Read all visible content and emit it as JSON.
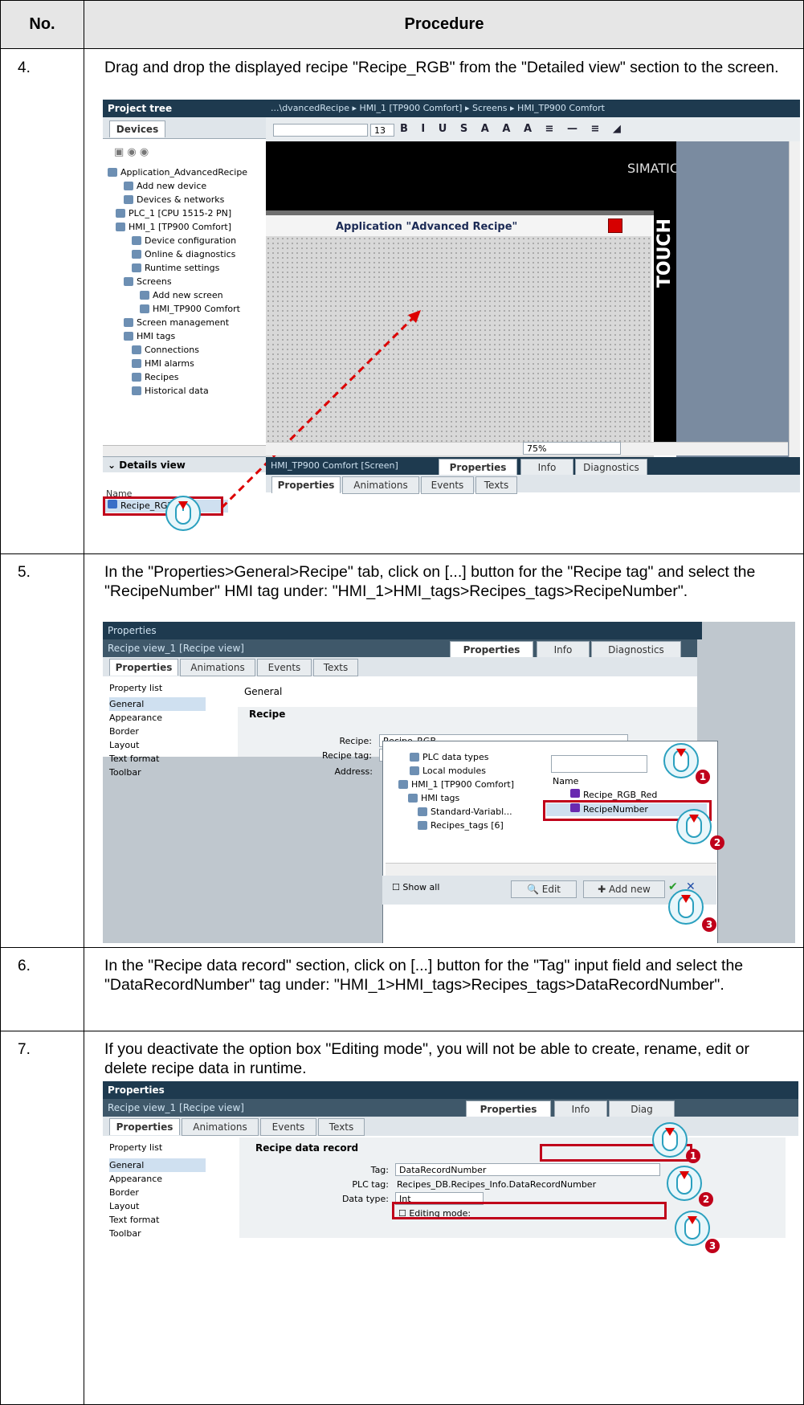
{
  "table": {
    "header_no": "No.",
    "header_procedure": "Procedure"
  },
  "steps": [
    {
      "no": "4.",
      "text": "Drag and drop the displayed recipe \"Recipe_RGB\" from the \"Detailed view\" section to the screen."
    },
    {
      "no": "5.",
      "text": "In the \"Properties>General>Recipe\" tab, click on [...] button for the \"Recipe tag\" and select the \"RecipeNumber\" HMI tag under: \"HMI_1>HMI_tags>Recipes_tags>RecipeNumber\"."
    },
    {
      "no": "6.",
      "text": "In the \"Recipe data record\" section, click on [...] button for the \"Tag\" input field and select the \"DataRecordNumber\" tag under: \"HMI_1>HMI_tags>Recipes_tags>DataRecordNumber\"."
    },
    {
      "no": "7.",
      "text": "If you deactivate the option box \"Editing mode\", you will not be able to create, rename, edit or delete recipe data in runtime."
    }
  ],
  "shot1": {
    "project_tree": "Project tree",
    "devices_tab": "Devices",
    "breadcrumb": "...\\dvancedRecipe ▸ HMI_1 [TP900 Comfort] ▸ Screens ▸ HMI_TP900 Comfort",
    "font_size": "13",
    "tree": [
      "Application_AdvancedRecipe",
      "Add new device",
      "Devices & networks",
      "PLC_1 [CPU 1515-2 PN]",
      "HMI_1 [TP900 Comfort]",
      "Device configuration",
      "Online & diagnostics",
      "Runtime settings",
      "Screens",
      "Add new screen",
      "HMI_TP900 Comfort",
      "Screen management",
      "HMI tags",
      "Connections",
      "HMI alarms",
      "Recipes",
      "Historical data"
    ],
    "details_view": "Details view",
    "name_col": "Name",
    "recipe_item": "Recipe_RGB",
    "simatic": "SIMATIC HMI",
    "touch": "TOUCH",
    "app_title": "Application \"Advanced Recipe\"",
    "zoom": "75%",
    "screen_label": "HMI_TP900 Comfort [Screen]",
    "properties": "Properties",
    "info": "Info",
    "diagnostics": "Diagnostics",
    "tabs": [
      "Properties",
      "Animations",
      "Events",
      "Texts"
    ]
  },
  "shot2": {
    "title": "Properties",
    "object": "Recipe view_1 [Recipe view]",
    "properties": "Properties",
    "info": "Info",
    "diagnostics": "Diagnostics",
    "tabs": [
      "Properties",
      "Animations",
      "Events",
      "Texts"
    ],
    "property_list": "Property list",
    "nav": [
      "General",
      "Appearance",
      "Border",
      "Layout",
      "Text format",
      "Toolbar"
    ],
    "general": "General",
    "section": "Recipe",
    "recipe_label": "Recipe:",
    "recipe_value": "Recipe_RGB",
    "recipe_tag_label": "Recipe tag:",
    "address_label": "Address:",
    "popup_tree": [
      "PLC data types",
      "Local modules",
      "HMI_1 [TP900 Comfort]",
      "HMI tags",
      "Standard-Variabl...",
      "Recipes_tags [6]"
    ],
    "popup_name": "Name",
    "popup_items": [
      "Recipe_RGB_Red",
      "RecipeNumber"
    ],
    "show_all": "Show all",
    "edit": "Edit",
    "add_new": "Add new"
  },
  "shot3": {
    "title": "Properties",
    "object": "Recipe view_1 [Recipe view]",
    "properties": "Properties",
    "info": "Info",
    "diagnostics": "Diag",
    "tabs": [
      "Properties",
      "Animations",
      "Events",
      "Texts"
    ],
    "property_list": "Property list",
    "nav": [
      "General",
      "Appearance",
      "Border",
      "Layout",
      "Text format",
      "Toolbar"
    ],
    "section": "Recipe data record",
    "tag_label": "Tag:",
    "tag_value": "DataRecordNumber",
    "plc_label": "PLC tag:",
    "plc_value": "Recipes_DB.Recipes_Info.DataRecordNumber",
    "type_label": "Data type:",
    "type_value": "Int",
    "editing_mode": "Editing mode:"
  },
  "markers": [
    "1",
    "2",
    "3"
  ]
}
